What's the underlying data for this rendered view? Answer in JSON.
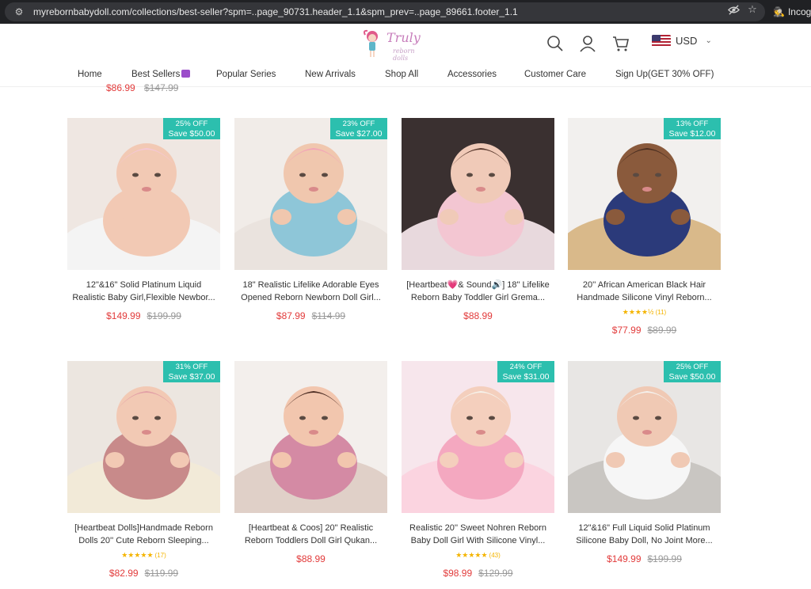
{
  "browser": {
    "url": "myrebornbabydoll.com/collections/best-seller?spm=..page_90731.header_1.1&spm_prev=..page_89661.footer_1.1",
    "profile": "Incog"
  },
  "header": {
    "logo_text": "Truly",
    "logo_sub": "reborn dolls",
    "currency": "USD",
    "nav": [
      "Home",
      "Best Sellers",
      "Popular Series",
      "New Arrivals",
      "Shop All",
      "Accessories",
      "Customer Care",
      "Sign Up(GET 30% OFF)"
    ]
  },
  "prev_row": {
    "sale": "$86.99",
    "compare": "$147.99"
  },
  "products": [
    {
      "badge_off": "25% OFF",
      "badge_save": "Save $50.00",
      "title1": "12\"&16\" Solid Platinum Liquid",
      "title2": "Realistic Baby Girl,Flexible Newbor...",
      "rating": "",
      "rating_count": "",
      "sale": "$149.99",
      "compare": "$199.99",
      "img": "sleeping"
    },
    {
      "badge_off": "23% OFF",
      "badge_save": "Save $27.00",
      "title1": "18\" Realistic Lifelike Adorable Eyes",
      "title2": "Opened Reborn Newborn Doll Girl...",
      "rating": "",
      "rating_count": "",
      "sale": "$87.99",
      "compare": "$114.99",
      "img": "blue-outfit"
    },
    {
      "badge_off": "",
      "badge_save": "",
      "title1": "[Heartbeat💗& Sound🔊] 18\" Lifelike",
      "title2": "Reborn Baby Toddler Girl Grema...",
      "rating": "",
      "rating_count": "",
      "sale": "$88.99",
      "compare": "",
      "img": "pink-pacifier"
    },
    {
      "badge_off": "13% OFF",
      "badge_save": "Save $12.00",
      "title1": "20'' African American Black Hair",
      "title2": "Handmade Silicone Vinyl Reborn...",
      "rating": "★★★★½",
      "rating_count": "(11)",
      "sale": "$77.99",
      "compare": "$89.99",
      "img": "african"
    },
    {
      "badge_off": "31% OFF",
      "badge_save": "Save $37.00",
      "title1": "[Heartbeat Dolls]Handmade Reborn",
      "title2": "Dolls 20'' Cute Reborn Sleeping...",
      "rating": "★★★★★",
      "rating_count": "(17)",
      "sale": "$82.99",
      "compare": "$119.99",
      "img": "floral-sleep"
    },
    {
      "badge_off": "",
      "badge_save": "",
      "title1": "[Heartbeat & Coos] 20\" Realistic",
      "title2": "Reborn Toddlers Doll Girl Qukan...",
      "rating": "",
      "rating_count": "",
      "sale": "$88.99",
      "compare": "",
      "img": "toddler-plush"
    },
    {
      "badge_off": "24% OFF",
      "badge_save": "Save $31.00",
      "title1": "Realistic 20'' Sweet Nohren Reborn",
      "title2": "Baby Doll Girl With Silicone Vinyl...",
      "rating": "★★★★★",
      "rating_count": "(43)",
      "sale": "$98.99",
      "compare": "$129.99",
      "img": "blonde-bottle"
    },
    {
      "badge_off": "25% OFF",
      "badge_save": "Save $50.00",
      "title1": "12\"&16\" Full Liquid Solid Platinum",
      "title2": "Silicone Baby Doll, No Joint More...",
      "rating": "",
      "rating_count": "",
      "sale": "$149.99",
      "compare": "$199.99",
      "img": "held-baby"
    }
  ]
}
